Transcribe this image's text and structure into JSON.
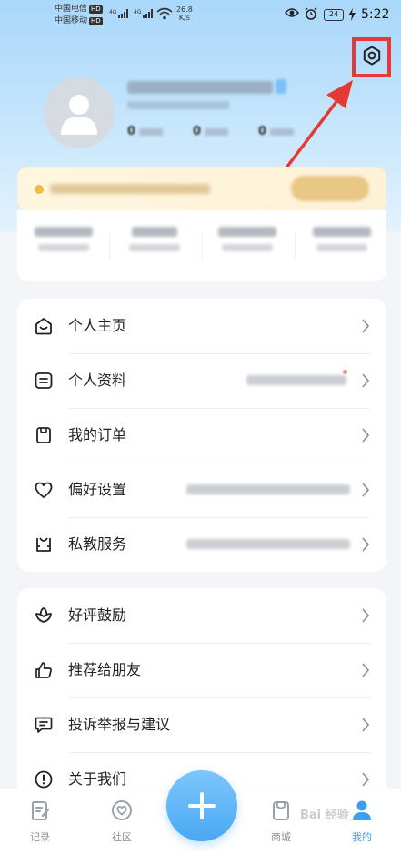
{
  "status_bar": {
    "carrier1": "中国电信",
    "carrier2": "中国移动",
    "hd": "HD",
    "signal": "4G",
    "speed_value": "26.8",
    "speed_unit": "K/s",
    "battery": "24",
    "time": "5:22"
  },
  "menu_group1": [
    {
      "label": "个人主页",
      "icon": "home-face-icon"
    },
    {
      "label": "个人资料",
      "icon": "profile-card-icon"
    },
    {
      "label": "我的订单",
      "icon": "shopping-bag-icon"
    },
    {
      "label": "偏好设置",
      "icon": "heart-icon"
    },
    {
      "label": "私教服务",
      "icon": "coach-icon"
    }
  ],
  "menu_group2": [
    {
      "label": "好评鼓励",
      "icon": "flower-icon"
    },
    {
      "label": "推荐给朋友",
      "icon": "thumb-up-icon"
    },
    {
      "label": "投诉举报与建议",
      "icon": "chat-icon"
    },
    {
      "label": "关于我们",
      "icon": "info-icon"
    }
  ],
  "bottom_nav": {
    "record": "记录",
    "community": "社区",
    "shop": "商城",
    "mine": "我的"
  },
  "colors": {
    "accent": "#3a9ef5",
    "highlight_box": "#e53935"
  }
}
